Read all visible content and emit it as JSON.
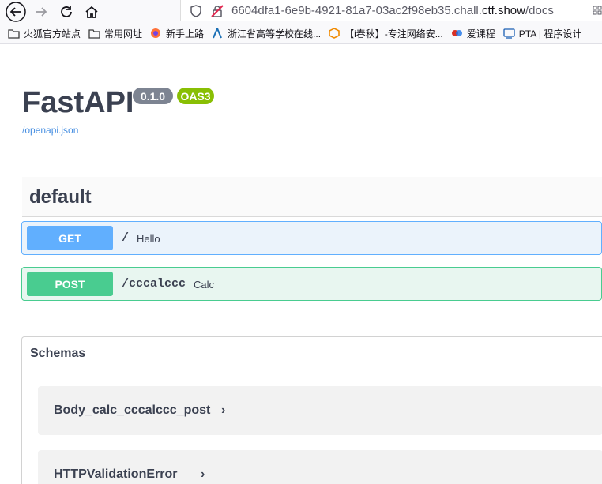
{
  "browser": {
    "url_prefix": "6604dfa1-6e9b-4921-81a7-03ac2f98eb35.chall.",
    "url_host": "ctf.show",
    "url_path": "/docs"
  },
  "bookmarks": [
    {
      "label": "火狐官方站点",
      "icon": "folder-icon"
    },
    {
      "label": "常用网址",
      "icon": "folder-icon"
    },
    {
      "label": "新手上路",
      "icon": "firefox-icon"
    },
    {
      "label": "浙江省高等学校在线...",
      "icon": "site-icon"
    },
    {
      "label": "【i春秋】-专注网络安...",
      "icon": "site-icon"
    },
    {
      "label": "爱课程",
      "icon": "site-icon"
    },
    {
      "label": "PTA | 程序设计",
      "icon": "site-icon"
    }
  ],
  "api": {
    "title": "FastAPI",
    "version": "0.1.0",
    "oas": "OAS3",
    "spec_link": "/openapi.json"
  },
  "tag": {
    "name": "default"
  },
  "operations": [
    {
      "method": "GET",
      "path": "/",
      "summary": "Hello"
    },
    {
      "method": "POST",
      "path": "/cccalccc",
      "summary": "Calc"
    }
  ],
  "schemas": {
    "title": "Schemas",
    "models": [
      "Body_calc_cccalccc_post",
      "HTTPValidationError"
    ]
  },
  "colors": {
    "get": "#61affe",
    "post": "#49cc90",
    "version_badge": "#7d8492",
    "oas_badge": "#89bf04"
  }
}
